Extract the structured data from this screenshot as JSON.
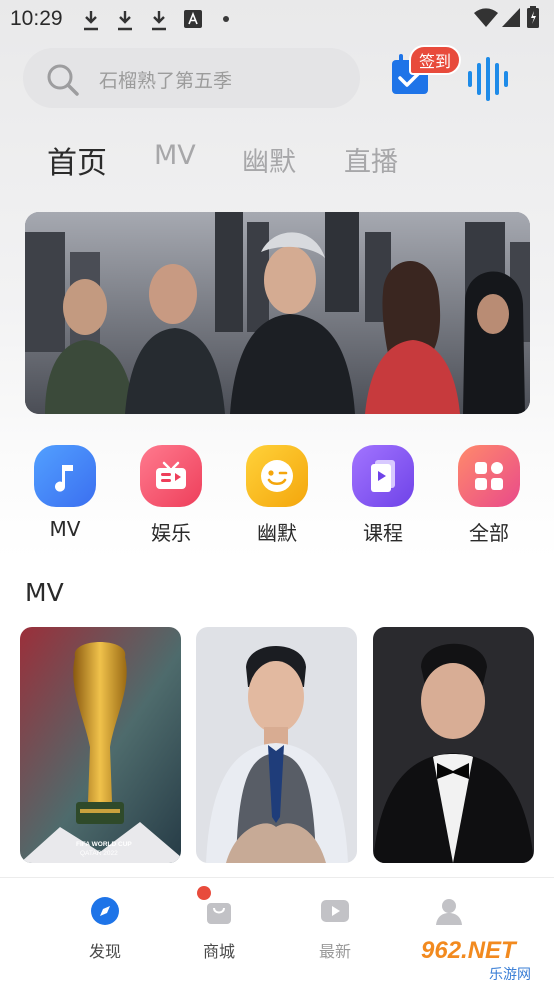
{
  "status_bar": {
    "time": "10:29",
    "icons": [
      "download-icon",
      "download-icon",
      "download-icon",
      "a-icon",
      "dot",
      "wifi-icon",
      "signal-icon",
      "battery-icon"
    ]
  },
  "search": {
    "placeholder": "石榴熟了第五季"
  },
  "header": {
    "checkin_badge": "签到"
  },
  "tabs": [
    {
      "label": "首页",
      "active": true
    },
    {
      "label": "MV",
      "active": false
    },
    {
      "label": "幽默",
      "active": false
    },
    {
      "label": "直播",
      "active": false
    }
  ],
  "quick_links": [
    {
      "label": "MV",
      "icon": "music-note-icon",
      "color": "#4a8cf7"
    },
    {
      "label": "娱乐",
      "icon": "tv-icon",
      "color": "#f0566e"
    },
    {
      "label": "幽默",
      "icon": "wink-face-icon",
      "color": "#f6b417"
    },
    {
      "label": "课程",
      "icon": "book-icon",
      "color": "#8d5cf2"
    },
    {
      "label": "全部",
      "icon": "grid-icon",
      "color": "#f06a7b"
    }
  ],
  "section": {
    "title": "MV"
  },
  "mv_cards": [
    {
      "caption_line1": "FIFA WORLD CUP",
      "caption_line2": "QATAR 2022"
    },
    {
      "caption_line1": "",
      "caption_line2": ""
    },
    {
      "caption_line1": "",
      "caption_line2": ""
    }
  ],
  "bottom_nav": [
    {
      "label": "发现",
      "icon": "compass-icon",
      "active": true
    },
    {
      "label": "商城",
      "icon": "shop-bag-icon",
      "active": false,
      "badge": true
    },
    {
      "label": "最新",
      "icon": "play-icon",
      "active": false
    },
    {
      "label": "",
      "icon": "user-icon",
      "active": false
    }
  ],
  "watermark": {
    "line1": "962.NET",
    "line2": "乐游网"
  },
  "colors": {
    "accent_blue": "#1e74e8",
    "badge_red": "#e84b3c"
  }
}
